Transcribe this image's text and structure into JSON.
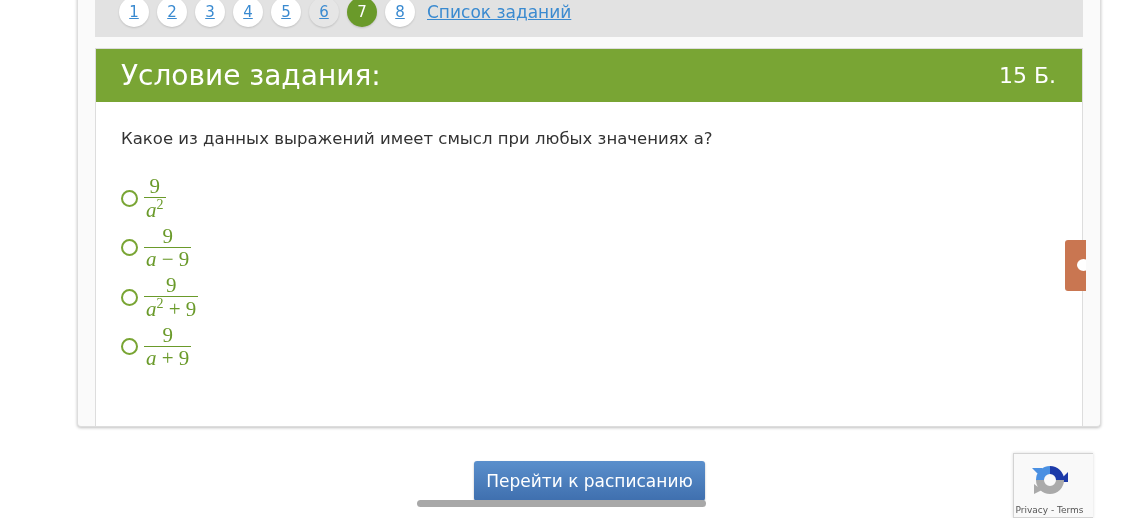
{
  "pager": {
    "pages": [
      {
        "label": "1",
        "selected": false,
        "visited": false
      },
      {
        "label": "2",
        "selected": false,
        "visited": false
      },
      {
        "label": "3",
        "selected": false,
        "visited": false
      },
      {
        "label": "4",
        "selected": false,
        "visited": false
      },
      {
        "label": "5",
        "selected": false,
        "visited": false
      },
      {
        "label": "6",
        "selected": false,
        "visited": true
      },
      {
        "label": "7",
        "selected": true,
        "visited": false
      },
      {
        "label": "8",
        "selected": false,
        "visited": false
      }
    ],
    "task_list_link": "Список заданий"
  },
  "task": {
    "title": "Условие задания:",
    "points": "15 Б.",
    "question": "Какое из данных выражений имеет смысл при любых значениях а?",
    "options": [
      {
        "numerator": "9",
        "denominator": "*a*$^{2}$",
        "selected": false
      },
      {
        "numerator": "9",
        "denominator": "*a* − 9",
        "selected": false
      },
      {
        "numerator": "9",
        "denominator": "*a*$^{2}$ + 9",
        "selected": false
      },
      {
        "numerator": "9",
        "denominator": "*a* + 9",
        "selected": false
      }
    ]
  },
  "schedule_button": "Перейти к расписанию",
  "recaptcha": {
    "links": "Privacy - Terms"
  }
}
